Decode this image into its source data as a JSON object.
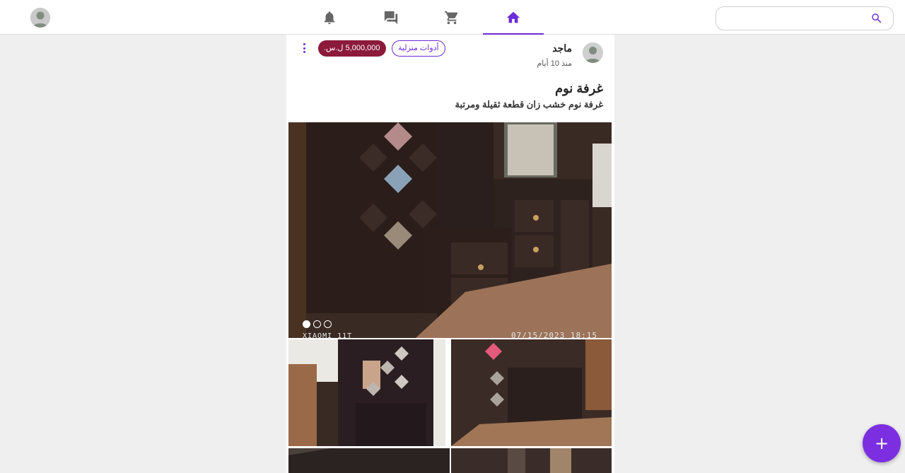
{
  "nav": {
    "tabs": [
      {
        "name": "notifications",
        "icon": "bell-icon",
        "active": false
      },
      {
        "name": "messages",
        "icon": "chat-icon",
        "active": false
      },
      {
        "name": "cart",
        "icon": "cart-icon",
        "active": false
      },
      {
        "name": "home",
        "icon": "home-icon",
        "active": true
      }
    ],
    "search": {
      "value": "",
      "placeholder": ""
    }
  },
  "post": {
    "author": "ماجد",
    "time": "منذ 10 أيام",
    "price": "5,000,000 ل.س.",
    "category": "أدوات منزلية",
    "title": "غرفة نوم",
    "description": "غرفة نوم خشب زان قطعة ثقيلة ومرتبة",
    "main_image": {
      "stamp_left": "XIAOMI 11T",
      "stamp_right": "07/15/2023  18:15",
      "slide_count": 3,
      "active_slide": 1
    }
  },
  "colors": {
    "accent": "#6c2bd9",
    "price_badge": "#8b1a3b",
    "fab": "#7b2fe0"
  },
  "fab": {
    "label": "+"
  }
}
